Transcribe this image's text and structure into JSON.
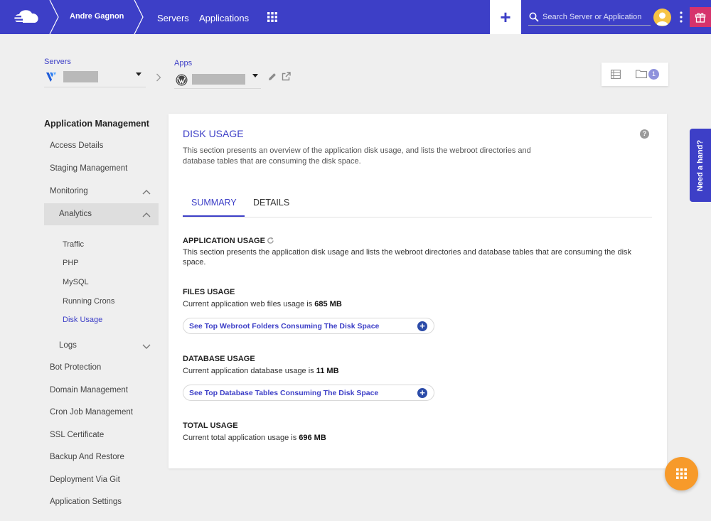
{
  "topbar": {
    "user_name": "Andre Gagnon",
    "nav": {
      "servers": "Servers",
      "applications": "Applications"
    },
    "add_label": "+",
    "search_placeholder": "Search Server or Application",
    "brand_color": "#3d3fc7",
    "icons": [
      "cloudways-logo-icon",
      "grid-icon",
      "search-icon",
      "avatar-icon",
      "kebab-menu-icon",
      "gift-icon"
    ]
  },
  "selectors": {
    "servers_label": "Servers",
    "apps_label": "Apps",
    "folder_badge": "1",
    "icons": [
      "vultr-icon",
      "wordpress-icon",
      "edit-icon",
      "external-link-icon",
      "list-view-icon",
      "folder-icon"
    ]
  },
  "sidebar": {
    "title": "Application Management",
    "items": {
      "access_details": "Access Details",
      "staging": "Staging Management",
      "monitoring": "Monitoring",
      "analytics": "Analytics",
      "traffic": "Traffic",
      "php": "PHP",
      "mysql": "MySQL",
      "running_crons": "Running Crons",
      "disk_usage": "Disk Usage",
      "logs": "Logs",
      "bot_protection": "Bot Protection",
      "domain_management": "Domain Management",
      "cron_job": "Cron Job Management",
      "ssl": "SSL Certificate",
      "backup": "Backup And Restore",
      "deployment": "Deployment Via Git",
      "app_settings": "Application Settings"
    }
  },
  "main": {
    "title": "DISK USAGE",
    "help": "?",
    "description": "This section presents an overview of the application disk usage, and lists the webroot directories and database tables that are consuming the disk space.",
    "tabs": {
      "summary": "SUMMARY",
      "details": "DETAILS"
    },
    "app_usage": {
      "title": "APPLICATION USAGE",
      "text": "This section presents the application disk usage and lists the webroot directories and database tables that are consuming the disk space."
    },
    "files_usage": {
      "title": "FILES USAGE",
      "text": "Current application web files usage is ",
      "value": "685 MB",
      "expander": "See Top Webroot Folders Consuming The Disk Space"
    },
    "db_usage": {
      "title": "DATABASE USAGE",
      "text": "Current application database usage is ",
      "value": "11 MB",
      "expander": "See Top Database Tables Consuming The Disk Space"
    },
    "total_usage": {
      "title": "TOTAL USAGE",
      "text": "Current total application usage is ",
      "value": "696 MB"
    }
  },
  "widgets": {
    "need_hand": "Need a hand?",
    "fab_icon": "grid-icon",
    "fab_color": "#f79a2a"
  }
}
